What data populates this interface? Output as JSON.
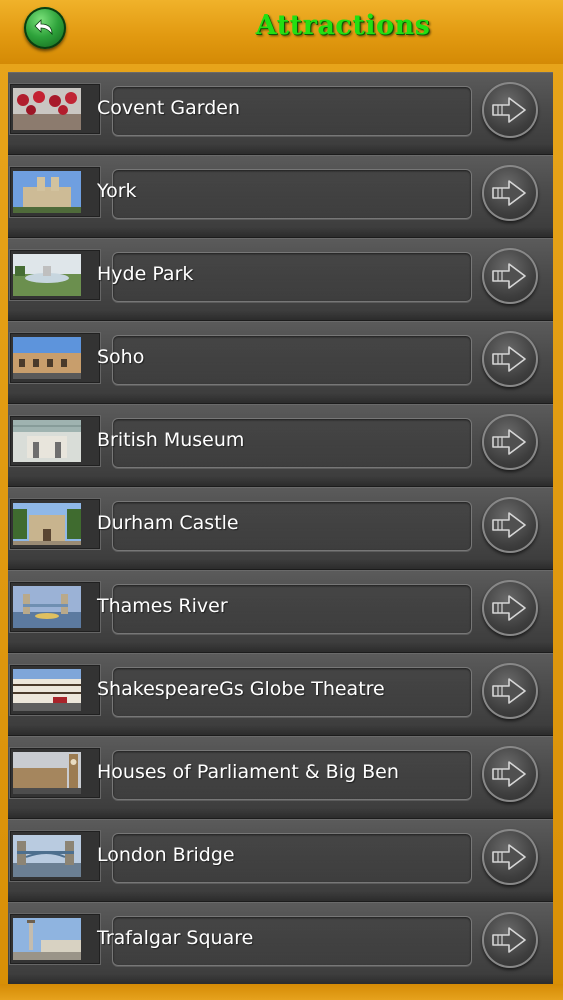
{
  "header": {
    "title": "Attractions",
    "back_icon": "back-arrow-icon",
    "colors": {
      "bar": "#e29a11",
      "title": "#22e012",
      "back_button": "#2ea33b"
    }
  },
  "list": {
    "items": [
      {
        "label": "Covent Garden",
        "thumbnail": "covent-garden-photo",
        "action_icon": "arrow-right-icon"
      },
      {
        "label": "York",
        "thumbnail": "york-photo",
        "action_icon": "arrow-right-icon"
      },
      {
        "label": "Hyde Park",
        "thumbnail": "hyde-park-photo",
        "action_icon": "arrow-right-icon"
      },
      {
        "label": "Soho",
        "thumbnail": "soho-photo",
        "action_icon": "arrow-right-icon"
      },
      {
        "label": "British Museum",
        "thumbnail": "british-museum-photo",
        "action_icon": "arrow-right-icon"
      },
      {
        "label": "Durham Castle",
        "thumbnail": "durham-castle-photo",
        "action_icon": "arrow-right-icon"
      },
      {
        "label": "Thames River",
        "thumbnail": "thames-river-photo",
        "action_icon": "arrow-right-icon"
      },
      {
        "label": "ShakespeareGs Globe Theatre",
        "thumbnail": "globe-theatre-photo",
        "action_icon": "arrow-right-icon"
      },
      {
        "label": "Houses of Parliament & Big Ben",
        "thumbnail": "parliament-photo",
        "action_icon": "arrow-right-icon"
      },
      {
        "label": "London Bridge",
        "thumbnail": "london-bridge-photo",
        "action_icon": "arrow-right-icon"
      },
      {
        "label": "Trafalgar Square",
        "thumbnail": "trafalgar-square-photo",
        "action_icon": "arrow-right-icon"
      }
    ]
  }
}
